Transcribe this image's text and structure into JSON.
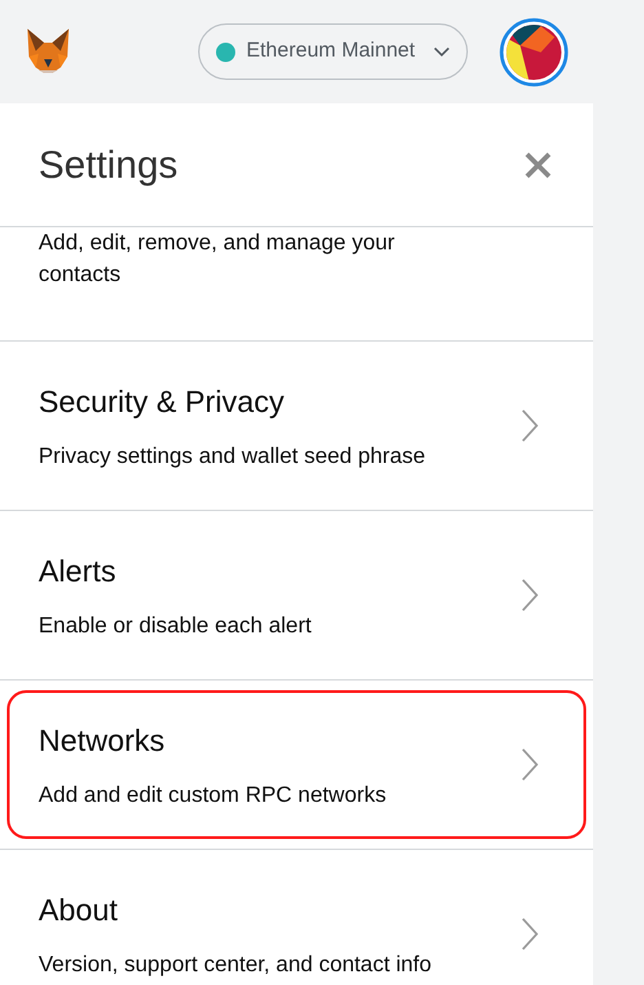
{
  "header": {
    "network": {
      "label": "Ethereum Mainnet",
      "color": "#29b6af"
    }
  },
  "settings": {
    "title": "Settings",
    "items": [
      {
        "description": "Add, edit, remove, and manage your contacts",
        "highlighted": false
      },
      {
        "title": "Security & Privacy",
        "description": "Privacy settings and wallet seed phrase",
        "highlighted": false
      },
      {
        "title": "Alerts",
        "description": "Enable or disable each alert",
        "highlighted": false
      },
      {
        "title": "Networks",
        "description": "Add and edit custom RPC networks",
        "highlighted": true
      },
      {
        "title": "About",
        "description": "Version, support center, and contact info",
        "highlighted": false
      }
    ]
  }
}
